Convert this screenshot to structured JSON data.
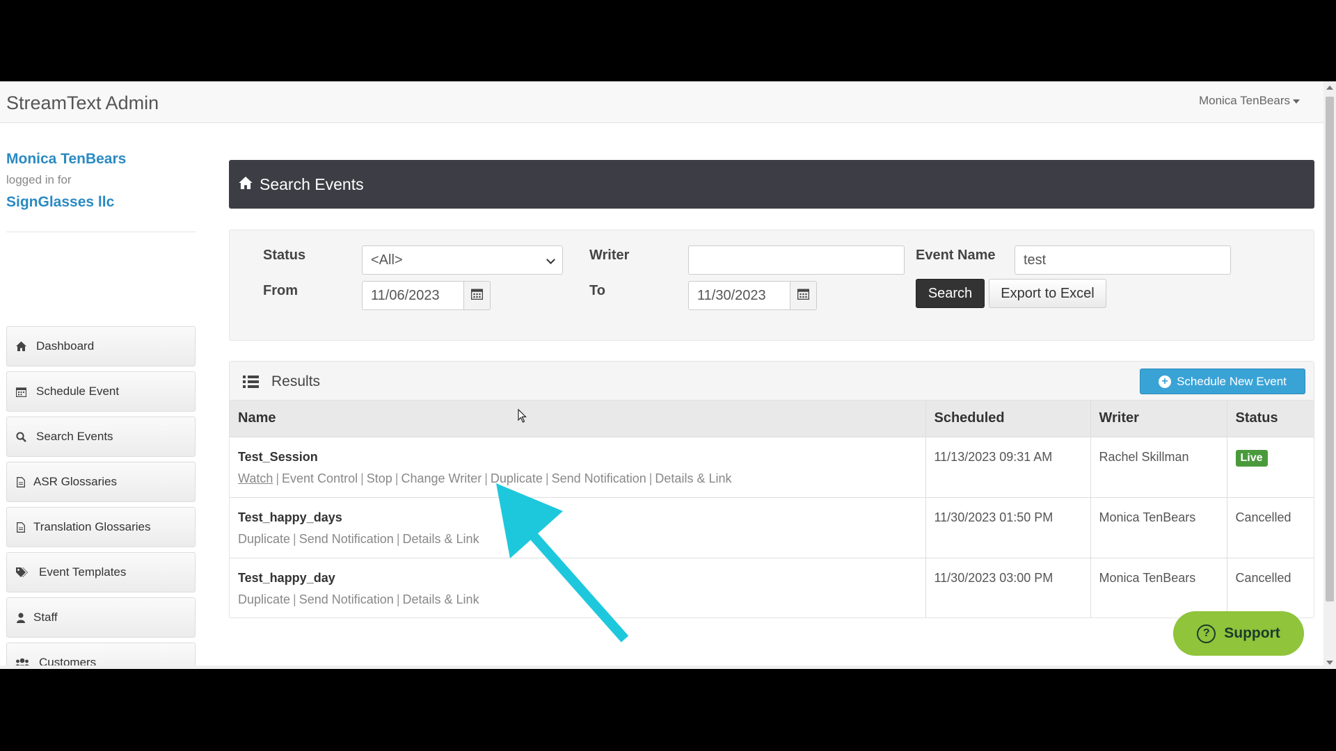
{
  "app": {
    "brand": "StreamText Admin",
    "user_menu": "Monica TenBears"
  },
  "sidebar": {
    "user": "Monica TenBears",
    "logged_in_for": "logged in for",
    "company": "SignGlasses llc",
    "items": [
      {
        "label": "Dashboard",
        "icon": "home-icon"
      },
      {
        "label": "Schedule Event",
        "icon": "calendar-icon"
      },
      {
        "label": "Search Events",
        "icon": "search-icon"
      },
      {
        "label": "ASR Glossaries",
        "icon": "file-icon"
      },
      {
        "label": "Translation Glossaries",
        "icon": "file-icon"
      },
      {
        "label": "Event Templates",
        "icon": "tags-icon"
      },
      {
        "label": "Staff",
        "icon": "user-icon"
      },
      {
        "label": "Customers",
        "icon": "users-icon"
      }
    ]
  },
  "page": {
    "title": "Search Events"
  },
  "filters": {
    "status_label": "Status",
    "status_value": "<All>",
    "writer_label": "Writer",
    "writer_value": "",
    "event_name_label": "Event Name",
    "event_name_value": "test",
    "from_label": "From",
    "from_value": "11/06/2023",
    "to_label": "To",
    "to_value": "11/30/2023",
    "search_button": "Search",
    "export_button": "Export to Excel"
  },
  "results": {
    "title": "Results",
    "new_button": "Schedule New Event",
    "columns": [
      "Name",
      "Scheduled",
      "Writer",
      "Status"
    ],
    "rows": [
      {
        "name": "Test_Session",
        "actions": [
          "Watch",
          "Event Control",
          "Stop",
          "Change Writer",
          "Duplicate",
          "Send Notification",
          "Details & Link"
        ],
        "scheduled": "11/13/2023 09:31 AM",
        "writer": "Rachel Skillman",
        "status": "Live"
      },
      {
        "name": "Test_happy_days",
        "actions": [
          "Duplicate",
          "Send Notification",
          "Details & Link"
        ],
        "scheduled": "11/30/2023 01:50 PM",
        "writer": "Monica TenBears",
        "status": "Cancelled"
      },
      {
        "name": "Test_happy_day",
        "actions": [
          "Duplicate",
          "Send Notification",
          "Details & Link"
        ],
        "scheduled": "11/30/2023 03:00 PM",
        "writer": "Monica TenBears",
        "status": "Cancelled"
      }
    ]
  },
  "support": {
    "label": "Support"
  },
  "colors": {
    "accent_arrow": "#1ec8dc",
    "live_badge": "#4a9a3c",
    "support_bg": "#8fc43b",
    "header_bg": "#3d3d45",
    "link_blue": "#2a8ac2"
  }
}
